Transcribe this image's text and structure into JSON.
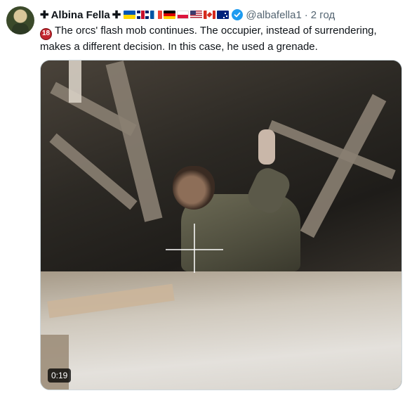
{
  "tweet": {
    "author": {
      "prefix_icon": "✚",
      "name": "Albina Fella",
      "suffix_icon": "✚",
      "flags": [
        "flag-ukraine-icon",
        "flag-uk-icon",
        "flag-france-icon",
        "flag-germany-icon",
        "flag-poland-icon",
        "flag-usa-icon",
        "flag-canada-icon",
        "flag-australia-icon"
      ],
      "verified": true,
      "handle": "@albafella1",
      "separator": "·",
      "time": "2 год"
    },
    "age_badge": "18",
    "text": "The orcs' flash mob continues. The occupier, instead of surrendering, makes a different decision. In this case, he used a grenade.",
    "media": {
      "type": "video",
      "duration": "0:19"
    }
  },
  "colors": {
    "verified_blue": "#1d9bf0",
    "secondary_text": "#536471",
    "badge_red": "#c3272f"
  }
}
